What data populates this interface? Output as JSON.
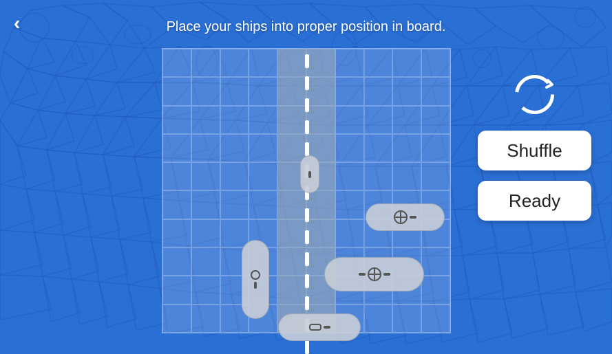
{
  "instruction": "Place your ships into proper position in board.",
  "back_button_label": "‹",
  "buttons": {
    "shuffle": "Shuffle",
    "ready": "Ready"
  },
  "grid": {
    "cols": 10,
    "rows": 10
  },
  "icons": {
    "rotate": "rotate-icon",
    "back": "back-arrow-icon"
  }
}
